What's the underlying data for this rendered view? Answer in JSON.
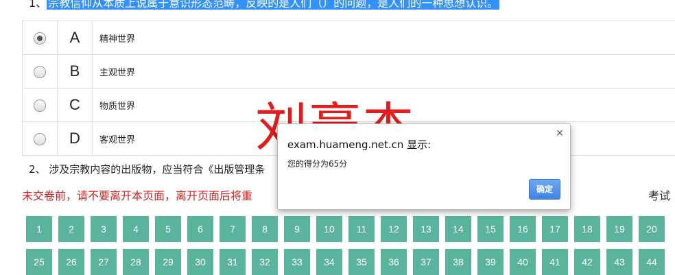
{
  "question1": {
    "number": "1、",
    "text": "宗教信仰从本质上说属于意识形态范畴，反映的是人们（）的问题，是人们的一种思想认识。"
  },
  "options": [
    {
      "letter": "A",
      "text": "精神世界",
      "checked": true
    },
    {
      "letter": "B",
      "text": "主观世界",
      "checked": false
    },
    {
      "letter": "C",
      "text": "物质世界",
      "checked": false
    },
    {
      "letter": "D",
      "text": "客观世界",
      "checked": false
    }
  ],
  "question2": {
    "text": "2、 涉及宗教内容的出版物，应当符合《出版管理条"
  },
  "warning": "未交卷前，请不要离开本页面，离开页面后将重",
  "exam_info": "考试",
  "watermark": "刘豪杰",
  "dialog": {
    "title": "exam.huameng.net.cn 显示:",
    "message": "您的得分为65分",
    "ok_label": "确定",
    "close_glyph": "×"
  },
  "question_numbers_row1": [
    "1",
    "2",
    "3",
    "4",
    "5",
    "6",
    "7",
    "8",
    "9",
    "10",
    "11",
    "12",
    "13",
    "14",
    "15",
    "16",
    "17",
    "18",
    "19",
    "20"
  ],
  "question_numbers_row2": [
    "25",
    "26",
    "27",
    "28",
    "29",
    "30",
    "31",
    "32",
    "33",
    "34",
    "35",
    "36",
    "37",
    "38",
    "39",
    "40",
    "41",
    "42",
    "43",
    "44"
  ],
  "colors": {
    "nav_button": "#5ab39b",
    "warning": "#d02020",
    "watermark": "#e01e1e",
    "selection": "#3390ff",
    "ok_button": "#3f82e6"
  }
}
